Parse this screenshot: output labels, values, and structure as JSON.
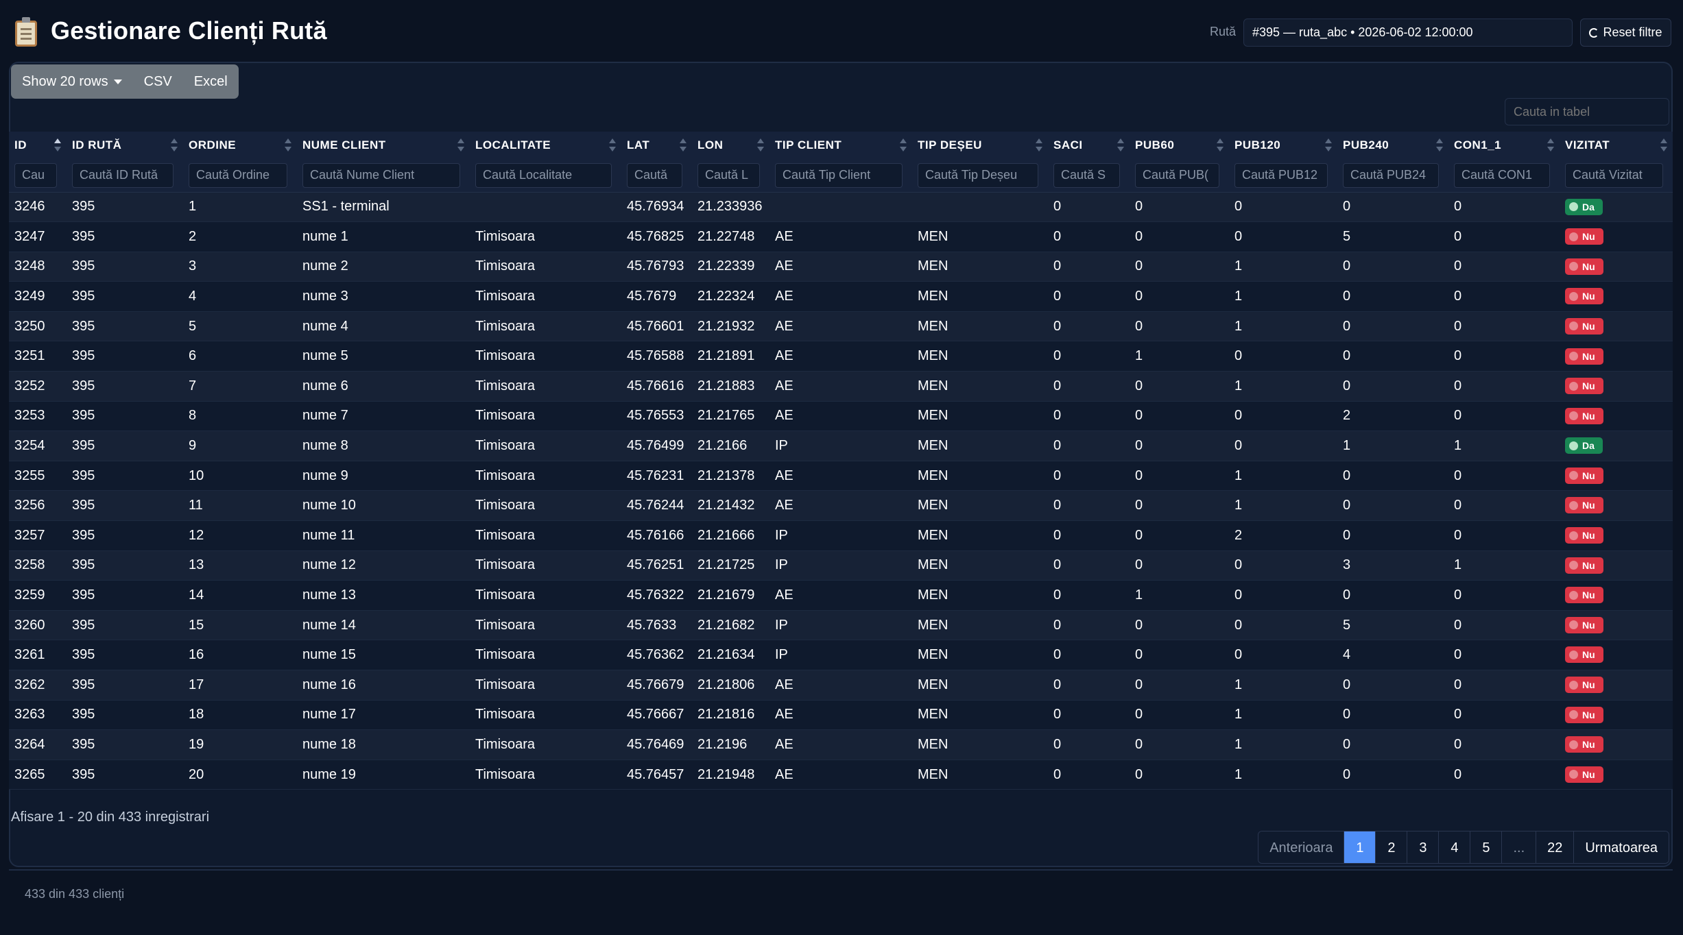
{
  "header": {
    "title": "Gestionare Clienți Rută",
    "route_label": "Rută",
    "route_value": "#395 — ruta_abc • 2026-06-02 12:00:00",
    "reset_label": "Reset filtre"
  },
  "toolbar": {
    "show_rows_label": "Show 20 rows",
    "csv_label": "CSV",
    "excel_label": "Excel",
    "search_placeholder": "Cauta in tabel"
  },
  "table": {
    "columns": [
      "ID",
      "ID RUTĂ",
      "ORDINE",
      "NUME CLIENT",
      "LOCALITATE",
      "LAT",
      "LON",
      "TIP CLIENT",
      "TIP DEȘEU",
      "SACI",
      "PUB60",
      "PUB120",
      "PUB240",
      "CON1_1",
      "VIZITAT"
    ],
    "filter_placeholders": [
      "Cau",
      "Caută ID Rută",
      "Caută Ordine",
      "Caută Nume Client",
      "Caută Localitate",
      "Caută",
      "Caută L",
      "Caută Tip Client",
      "Caută Tip Deșeu",
      "Caută S",
      "Caută PUB(",
      "Caută PUB12",
      "Caută PUB24",
      "Caută CON1",
      "Caută Vizitat"
    ],
    "rows": [
      [
        "3246",
        "395",
        "1",
        "SS1 - terminal",
        "",
        "45.76934",
        "21.233936",
        "",
        "",
        "0",
        "0",
        "0",
        "0",
        "0",
        "Da"
      ],
      [
        "3247",
        "395",
        "2",
        "nume 1",
        "Timisoara",
        "45.76825",
        "21.22748",
        "AE",
        "MEN",
        "0",
        "0",
        "0",
        "5",
        "0",
        "Nu"
      ],
      [
        "3248",
        "395",
        "3",
        "nume 2",
        "Timisoara",
        "45.76793",
        "21.22339",
        "AE",
        "MEN",
        "0",
        "0",
        "1",
        "0",
        "0",
        "Nu"
      ],
      [
        "3249",
        "395",
        "4",
        "nume 3",
        "Timisoara",
        "45.7679",
        "21.22324",
        "AE",
        "MEN",
        "0",
        "0",
        "1",
        "0",
        "0",
        "Nu"
      ],
      [
        "3250",
        "395",
        "5",
        "nume 4",
        "Timisoara",
        "45.76601",
        "21.21932",
        "AE",
        "MEN",
        "0",
        "0",
        "1",
        "0",
        "0",
        "Nu"
      ],
      [
        "3251",
        "395",
        "6",
        "nume 5",
        "Timisoara",
        "45.76588",
        "21.21891",
        "AE",
        "MEN",
        "0",
        "1",
        "0",
        "0",
        "0",
        "Nu"
      ],
      [
        "3252",
        "395",
        "7",
        "nume 6",
        "Timisoara",
        "45.76616",
        "21.21883",
        "AE",
        "MEN",
        "0",
        "0",
        "1",
        "0",
        "0",
        "Nu"
      ],
      [
        "3253",
        "395",
        "8",
        "nume 7",
        "Timisoara",
        "45.76553",
        "21.21765",
        "AE",
        "MEN",
        "0",
        "0",
        "0",
        "2",
        "0",
        "Nu"
      ],
      [
        "3254",
        "395",
        "9",
        "nume 8",
        "Timisoara",
        "45.76499",
        "21.2166",
        "IP",
        "MEN",
        "0",
        "0",
        "0",
        "1",
        "1",
        "Da"
      ],
      [
        "3255",
        "395",
        "10",
        "nume 9",
        "Timisoara",
        "45.76231",
        "21.21378",
        "AE",
        "MEN",
        "0",
        "0",
        "1",
        "0",
        "0",
        "Nu"
      ],
      [
        "3256",
        "395",
        "11",
        "nume 10",
        "Timisoara",
        "45.76244",
        "21.21432",
        "AE",
        "MEN",
        "0",
        "0",
        "1",
        "0",
        "0",
        "Nu"
      ],
      [
        "3257",
        "395",
        "12",
        "nume 11",
        "Timisoara",
        "45.76166",
        "21.21666",
        "IP",
        "MEN",
        "0",
        "0",
        "2",
        "0",
        "0",
        "Nu"
      ],
      [
        "3258",
        "395",
        "13",
        "nume 12",
        "Timisoara",
        "45.76251",
        "21.21725",
        "IP",
        "MEN",
        "0",
        "0",
        "0",
        "3",
        "1",
        "Nu"
      ],
      [
        "3259",
        "395",
        "14",
        "nume 13",
        "Timisoara",
        "45.76322",
        "21.21679",
        "AE",
        "MEN",
        "0",
        "1",
        "0",
        "0",
        "0",
        "Nu"
      ],
      [
        "3260",
        "395",
        "15",
        "nume 14",
        "Timisoara",
        "45.7633",
        "21.21682",
        "IP",
        "MEN",
        "0",
        "0",
        "0",
        "5",
        "0",
        "Nu"
      ],
      [
        "3261",
        "395",
        "16",
        "nume 15",
        "Timisoara",
        "45.76362",
        "21.21634",
        "IP",
        "MEN",
        "0",
        "0",
        "0",
        "4",
        "0",
        "Nu"
      ],
      [
        "3262",
        "395",
        "17",
        "nume 16",
        "Timisoara",
        "45.76679",
        "21.21806",
        "AE",
        "MEN",
        "0",
        "0",
        "1",
        "0",
        "0",
        "Nu"
      ],
      [
        "3263",
        "395",
        "18",
        "nume 17",
        "Timisoara",
        "45.76667",
        "21.21816",
        "AE",
        "MEN",
        "0",
        "0",
        "1",
        "0",
        "0",
        "Nu"
      ],
      [
        "3264",
        "395",
        "19",
        "nume 18",
        "Timisoara",
        "45.76469",
        "21.2196",
        "AE",
        "MEN",
        "0",
        "0",
        "1",
        "0",
        "0",
        "Nu"
      ],
      [
        "3265",
        "395",
        "20",
        "nume 19",
        "Timisoara",
        "45.76457",
        "21.21948",
        "AE",
        "MEN",
        "0",
        "0",
        "1",
        "0",
        "0",
        "Nu"
      ]
    ]
  },
  "footer": {
    "info_text": "Afisare 1 - 20 din 433 inregistrari",
    "count_text": "433 din 433 clienți"
  },
  "pagination": {
    "prev_label": "Anterioara",
    "pages": [
      "1",
      "2",
      "3",
      "4",
      "5",
      "...",
      "22"
    ],
    "current_page": "1",
    "next_label": "Urmatoarea"
  },
  "colors": {
    "badge_yes": "#198754",
    "badge_no": "#dc3545",
    "active_page": "#4f8ef7"
  }
}
